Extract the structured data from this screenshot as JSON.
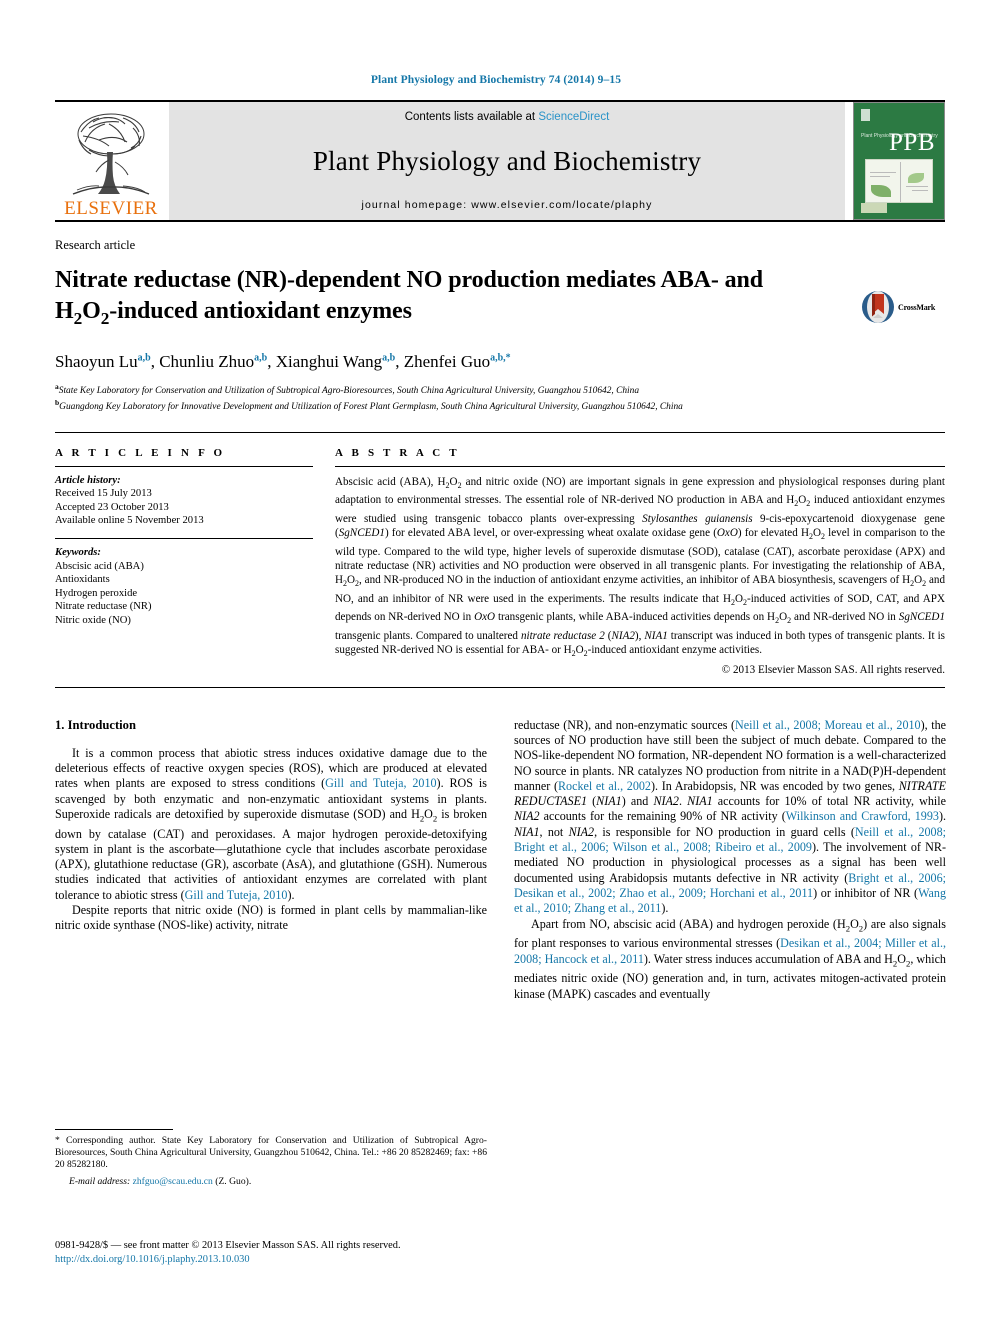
{
  "running_head": "Plant Physiology and Biochemistry 74 (2014) 9–15",
  "masthead": {
    "publisher_word": "ELSEVIER",
    "contents_prefix": "Contents lists available at ",
    "contents_link": "ScienceDirect",
    "journal_name": "Plant Physiology and Biochemistry",
    "homepage": "journal homepage: www.elsevier.com/locate/plaphy",
    "cover_abbrev": "PPB",
    "cover_journal_title": "Plant Physiology and Biochemistry"
  },
  "article": {
    "category": "Research article",
    "title_line1": "Nitrate reductase (NR)-dependent NO production mediates ABA- and",
    "title_line2_a": "H",
    "title_line2_sub1": "2",
    "title_line2_b": "O",
    "title_line2_sub2": "2",
    "title_line2_c": "-induced antioxidant enzymes",
    "crossmark_label": "CrossMark",
    "authors": [
      {
        "name": "Shaoyun Lu",
        "sup": "a,b",
        "sep": ", "
      },
      {
        "name": "Chunliu Zhuo",
        "sup": "a,b",
        "sep": ", "
      },
      {
        "name": "Xianghui Wang",
        "sup": "a,b",
        "sep": ", "
      },
      {
        "name": "Zhenfei Guo",
        "sup": "a,b,*",
        "sep": ""
      }
    ],
    "affiliations": [
      {
        "marker": "a",
        "text": "State Key Laboratory for Conservation and Utilization of Subtropical Agro-Bioresources, South China Agricultural University, Guangzhou 510642, China"
      },
      {
        "marker": "b",
        "text": "Guangdong Key Laboratory for Innovative Development and Utilization of Forest Plant Germplasm, South China Agricultural University, Guangzhou 510642, China"
      }
    ]
  },
  "article_info": {
    "heading": "A R T I C L E  I N F O",
    "history_label": "Article history:",
    "history": [
      "Received 15 July 2013",
      "Accepted 23 October 2013",
      "Available online 5 November 2013"
    ],
    "keywords_label": "Keywords:",
    "keywords": [
      "Abscisic acid (ABA)",
      "Antioxidants",
      "Hydrogen peroxide",
      "Nitrate reductase (NR)",
      "Nitric oxide (NO)"
    ]
  },
  "abstract": {
    "heading": "A B S T R A C T",
    "copyright": "© 2013 Elsevier Masson SAS. All rights reserved."
  },
  "intro": {
    "heading": "1.  Introduction"
  },
  "footnote": {
    "corresponding": "* Corresponding author. State Key Laboratory for Conservation and Utilization of Subtropical Agro-Bioresources, South China Agricultural University, Guangzhou 510642, China. Tel.: +86 20 85282469; fax: +86 20 85282180.",
    "email_label": "E-mail address:",
    "email": "zhfguo@scau.edu.cn",
    "email_owner": "(Z. Guo)."
  },
  "imprint": {
    "line1": "0981-9428/$ — see front matter © 2013 Elsevier Masson SAS. All rights reserved.",
    "doi": "http://dx.doi.org/10.1016/j.plaphy.2013.10.030"
  },
  "colors": {
    "link": "#1577a8",
    "sciencedirect": "#2a93c8",
    "elsevier_orange": "#e8700d",
    "cover_green": "#2c7a43",
    "masthead_gray": "#e3e3e3"
  }
}
